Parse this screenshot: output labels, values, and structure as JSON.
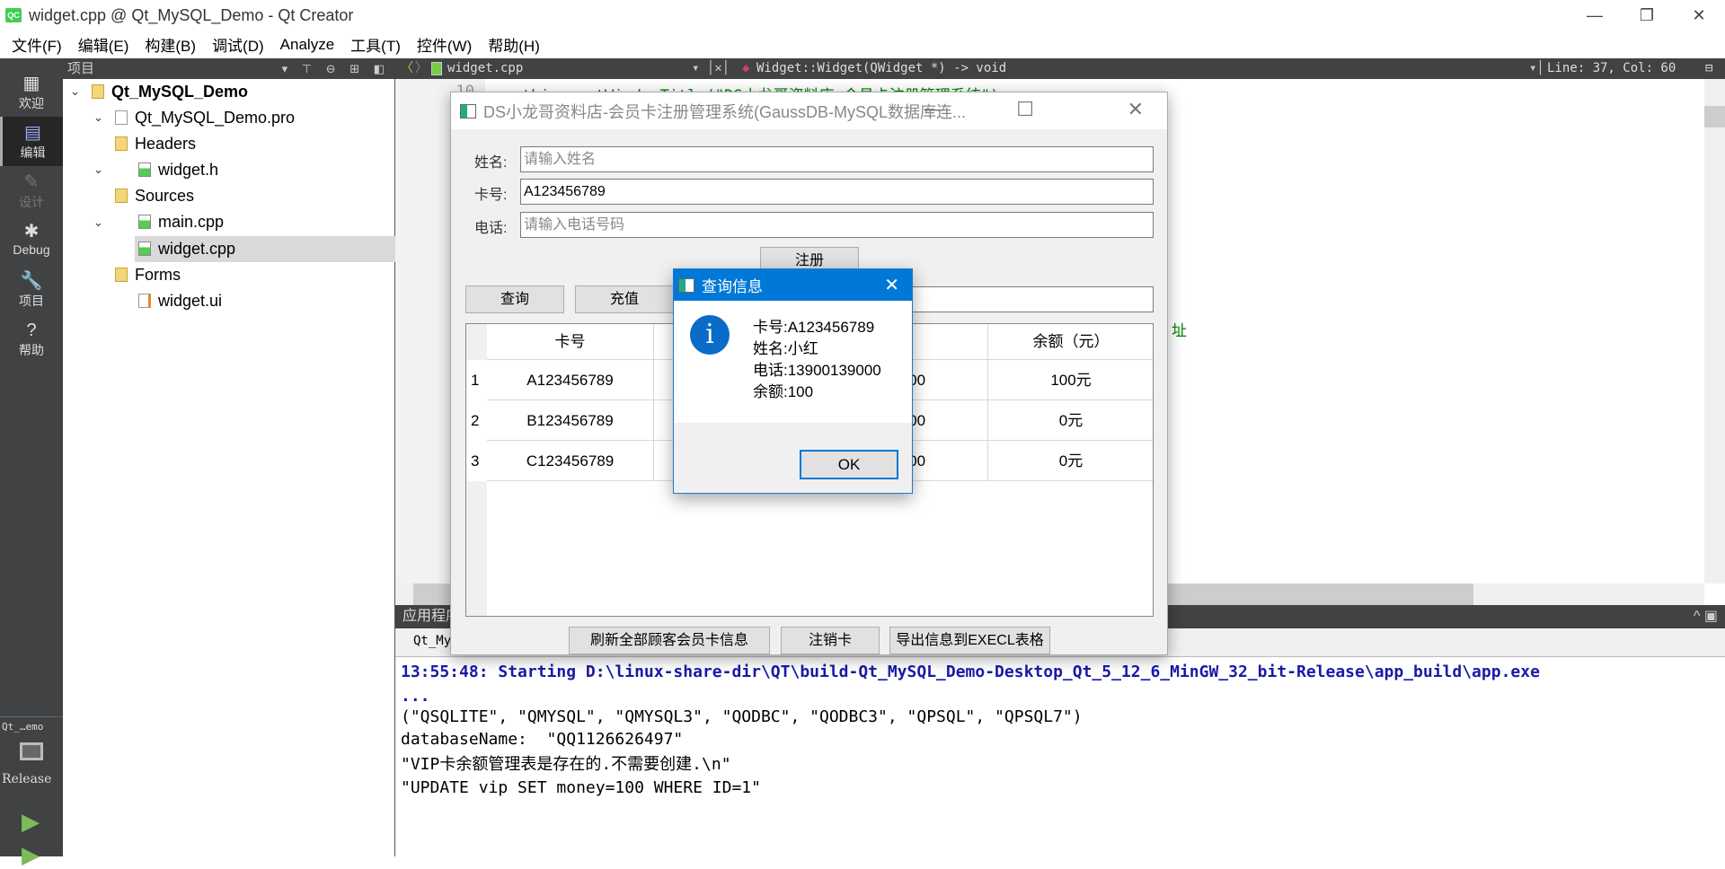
{
  "window": {
    "title": "widget.cpp @ Qt_MySQL_Demo - Qt Creator",
    "app_icon": "QC"
  },
  "menu": [
    "文件(F)",
    "编辑(E)",
    "构建(B)",
    "调试(D)",
    "Analyze",
    "工具(T)",
    "控件(W)",
    "帮助(H)"
  ],
  "modes": [
    {
      "label": "欢迎",
      "icon": "grid-icon"
    },
    {
      "label": "编辑",
      "icon": "edit-doc-icon"
    },
    {
      "label": "设计",
      "icon": "pencil-icon"
    },
    {
      "label": "Debug",
      "icon": "bug-icon"
    },
    {
      "label": "项目",
      "icon": "wrench-icon"
    },
    {
      "label": "帮助",
      "icon": "help-icon"
    }
  ],
  "kit": {
    "project": "Qt_…emo",
    "build": "Release"
  },
  "project_panel": {
    "title": "项目",
    "tree": [
      "Qt_MySQL_Demo",
      "Qt_MySQL_Demo.pro",
      "Headers",
      "widget.h",
      "Sources",
      "main.cpp",
      "widget.cpp",
      "Forms",
      "widget.ui"
    ]
  },
  "editor": {
    "file": "widget.cpp",
    "function": "Widget::Widget(QWidget *) -> void",
    "position": "Line: 37, Col: 60",
    "line_numbers": [
      "10",
      "1",
      "1",
      "1",
      "1",
      "1",
      "1",
      "1",
      "1",
      "1",
      "2",
      "2",
      "2",
      "2",
      "2",
      "2"
    ],
    "code_line": "    this->setWindowTitle(\"DS小龙哥资料店-会员卡注册管理系统\");",
    "code_fragment": "址"
  },
  "output": {
    "header": "应用程序",
    "tab": "Qt_My",
    "lines": [
      "13:55:48: Starting D:\\linux-share-dir\\QT\\build-Qt_MySQL_Demo-Desktop_Qt_5_12_6_MinGW_32_bit-Release\\app_build\\app.exe",
      "...",
      "(\"QSQLITE\", \"QMYSQL\", \"QMYSQL3\", \"QODBC\", \"QODBC3\", \"QPSQL\", \"QPSQL7\")",
      "databaseName:  \"QQ1126626497\"",
      "\"VIP卡余额管理表是存在的.不需要创建.\\n\"",
      "\"UPDATE vip SET money=100 WHERE ID=1\""
    ]
  },
  "app": {
    "title": "DS小龙哥资料店-会员卡注册管理系统(GaussDB-MySQL数据库连...",
    "name_label": "姓名:",
    "name_placeholder": "请输入姓名",
    "card_label": "卡号:",
    "card_value": "A123456789",
    "phone_label": "电话:",
    "phone_placeholder": "请输入电话号码",
    "register": "注册",
    "query": "查询",
    "recharge": "充值",
    "table": {
      "headers": [
        "卡号",
        "",
        "话",
        "余额（元）"
      ],
      "rows": [
        {
          "n": "1",
          "card": "A123456789",
          "phone": "39000",
          "balance": "100元"
        },
        {
          "n": "2",
          "card": "B123456789",
          "phone": "39000",
          "balance": "0元"
        },
        {
          "n": "3",
          "card": "C123456789",
          "phone": "39000",
          "balance": "0元"
        }
      ]
    },
    "refresh": "刷新全部顾客会员卡信息",
    "cancel_card": "注销卡",
    "export": "导出信息到EXECL表格"
  },
  "dialog": {
    "title": "查询信息",
    "icon": "info-icon",
    "lines": [
      "卡号:A123456789",
      "姓名:小红",
      "电话:13900139000",
      "余额:100"
    ],
    "ok": "OK"
  }
}
